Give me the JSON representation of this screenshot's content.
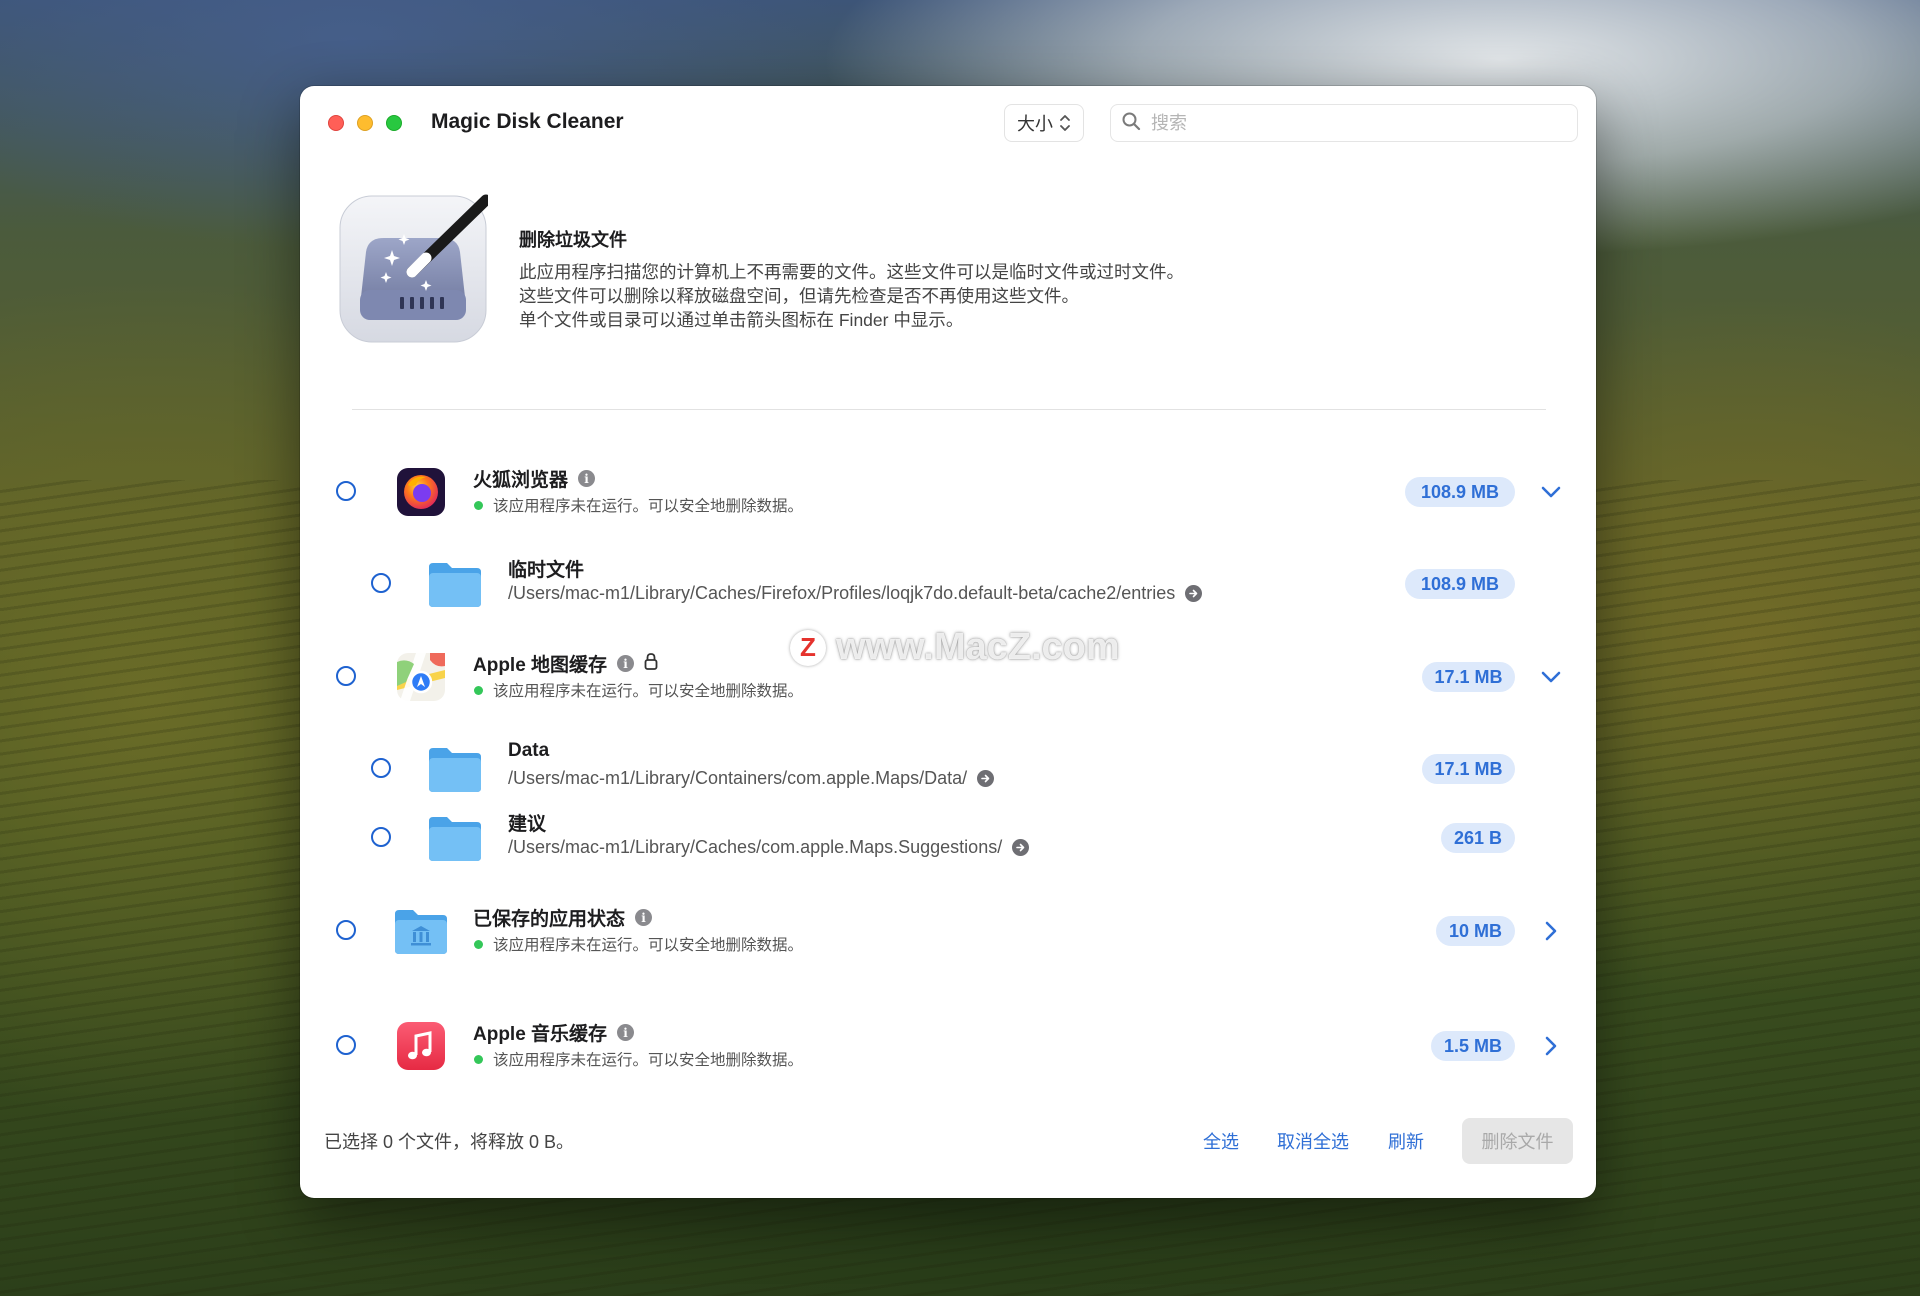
{
  "window": {
    "title": "Magic Disk Cleaner",
    "sort": {
      "label": "大小"
    },
    "search": {
      "placeholder": "搜索",
      "value": ""
    }
  },
  "header": {
    "heading": "删除垃圾文件",
    "description": [
      "此应用程序扫描您的计算机上不再需要的文件。这些文件可以是临时文件或过时文件。",
      "这些文件可以删除以释放磁盘空间，但请先检查是否不再使用这些文件。",
      "单个文件或目录可以通过单击箭头图标在 Finder 中显示。"
    ]
  },
  "items": [
    {
      "name": "火狐浏览器",
      "status": "该应用程序未在运行。可以安全地删除数据。",
      "size": "108.9 MB",
      "expanded": true,
      "icon": "firefox-icon",
      "children": [
        {
          "name": "临时文件",
          "path": "/Users/mac-m1/Library/Caches/Firefox/Profiles/loqjk7do.default-beta/cache2/entries",
          "size": "108.9 MB"
        }
      ]
    },
    {
      "name": "Apple 地图缓存",
      "status": "该应用程序未在运行。可以安全地删除数据。",
      "size": "17.1 MB",
      "expanded": true,
      "locked": true,
      "icon": "apple-maps-icon",
      "children": [
        {
          "name": "Data",
          "path": "/Users/mac-m1/Library/Containers/com.apple.Maps/Data/",
          "size": "17.1 MB"
        },
        {
          "name": "建议",
          "path": "/Users/mac-m1/Library/Caches/com.apple.Maps.Suggestions/",
          "size": "261 B"
        }
      ]
    },
    {
      "name": "已保存的应用状态",
      "status": "该应用程序未在运行。可以安全地删除数据。",
      "size": "10 MB",
      "expanded": false,
      "icon": "saved-state-folder-icon"
    },
    {
      "name": "Apple 音乐缓存",
      "status": "该应用程序未在运行。可以安全地删除数据。",
      "size": "1.5 MB",
      "expanded": false,
      "icon": "apple-music-icon"
    }
  ],
  "footer": {
    "summary": "已选择 0 个文件，将释放 0 B。",
    "select_all": "全选",
    "deselect_all": "取消全选",
    "refresh": "刷新",
    "delete": "删除文件"
  },
  "watermark": "www.MacZ.com",
  "colors": {
    "accent": "#2f6fd6",
    "badge_bg": "#dde9fb",
    "status_ok": "#34c759",
    "folder": "#5fb4f0"
  }
}
